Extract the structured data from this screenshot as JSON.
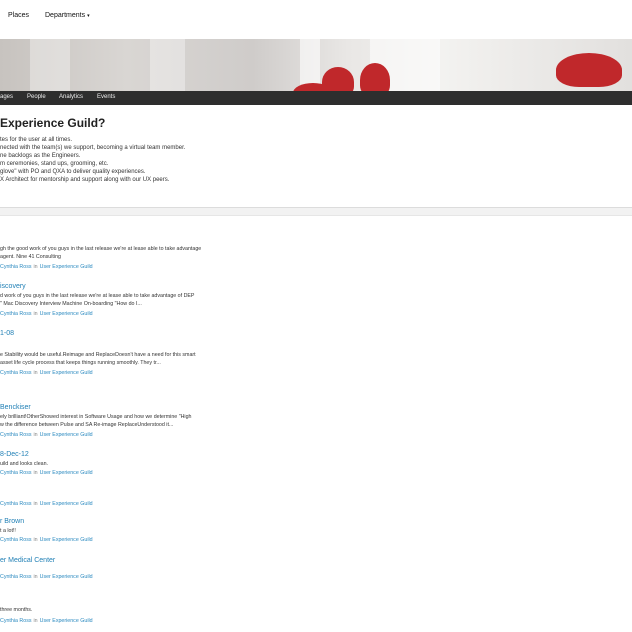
{
  "topnav": {
    "places": "Places",
    "departments": "Departments",
    "caret": "▾"
  },
  "subnav": [
    "ages",
    "People",
    "Analytics",
    "Events"
  ],
  "guild": {
    "title": "Experience Guild?",
    "lines": [
      "tes for the user at all times.",
      "nected with the team(s) we support, becoming a virtual team member.",
      "ne backlogs as the Engineers.",
      "m ceremonies, stand ups, grooming, etc.",
      "glove\" with PO and QXA to deliver quality experiences.",
      "X Architect for mentorship and support along with our UX peers."
    ]
  },
  "posts": [
    {
      "title": "",
      "excerpt": [
        "gh the good work of you guys in the last release we're at lease able to take advantage",
        " agent. Nine 41 Consulting"
      ],
      "author": "Cynthia Ross",
      "in": "in",
      "place": "User Experience Guild"
    },
    {
      "title": "iscovery",
      "excerpt": [
        "d work of you guys in the last release we're at lease able to take advantage of DEP",
        "\" Mac Discovery Interview Machine On-boarding \"How do I..."
      ],
      "author": "Cynthia Ross",
      "in": "in",
      "place": "User Experience Guild"
    },
    {
      "title": "1-08",
      "excerpt": [
        "",
        "",
        "",
        "e Stability would be useful.Reimage and ReplaceDoesn't have a need for this smart",
        "asset life cycle process that keeps things running smoothly. They tr..."
      ],
      "author": "Cynthia Ross",
      "in": "in",
      "place": "User Experience Guild"
    },
    {
      "title": "Benckiser",
      "excerpt": [
        "ely brilliant!OtherShowed interest in Software Usage and how we determine \"High",
        "w the difference between Pulse and SA Re-image ReplaceUnderstood it..."
      ],
      "author": "Cynthia Ross",
      "in": "in",
      "place": "User Experience Guild"
    },
    {
      "title": "8-Dec-12",
      "excerpt": [
        "uild and looks clean."
      ],
      "author": "Cynthia Ross",
      "in": "in",
      "place": "User Experience Guild"
    },
    {
      "title": "",
      "excerpt": [],
      "author": "Cynthia Ross",
      "in": "in",
      "place": "User Experience Guild"
    },
    {
      "title": "r Brown",
      "excerpt": [
        "t a lot!!"
      ],
      "author": "Cynthia Ross",
      "in": "in",
      "place": "User Experience Guild"
    },
    {
      "title": "er Medical Center",
      "excerpt": [],
      "author": "Cynthia Ross",
      "in": "in",
      "place": "User Experience Guild"
    },
    {
      "title": "",
      "excerpt": [
        "three months."
      ],
      "author": "Cynthia Ross",
      "in": "in",
      "place": "User Experience Guild"
    }
  ]
}
